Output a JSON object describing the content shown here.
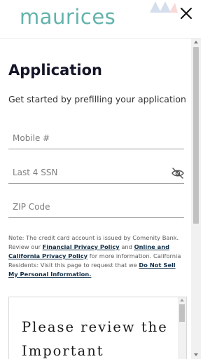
{
  "brand": {
    "logo_text": "maurices",
    "logo_color": "#63b3ab"
  },
  "header": {
    "close_icon": "close-icon"
  },
  "main": {
    "title": "Application",
    "subtitle": "Get started by prefilling your application",
    "fields": {
      "mobile_placeholder": "Mobile #",
      "ssn_placeholder": "Last 4 SSN",
      "ssn_icon": "eye-slash-icon",
      "zip_placeholder": "ZIP Code"
    },
    "note": {
      "text_1": "Note: The credit card account is issued by Comenity Bank. Review our ",
      "link_financial": "Financial Privacy Policy",
      "text_2": " and ",
      "link_online": "Online and California Privacy Policy",
      "text_3": " for more information. California Residents: Visit this page to request that we ",
      "link_dns": "Do Not Sell My Personal Information."
    },
    "terms_preview": "Please review the Important"
  },
  "colors": {
    "title": "#141428",
    "link": "#12304a",
    "accent": "#63b3ab"
  }
}
